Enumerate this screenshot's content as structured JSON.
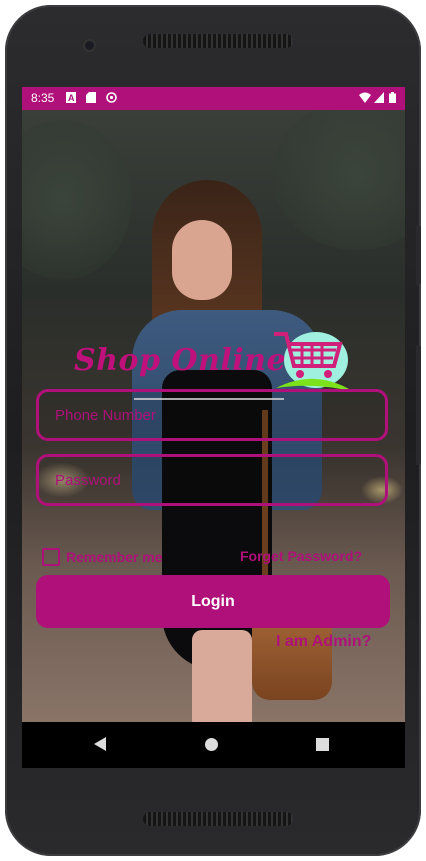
{
  "status_bar": {
    "time": "8:35",
    "left_icons": [
      "notification-a-icon",
      "sd-card-icon",
      "sync-icon"
    ],
    "right_icons": [
      "wifi-icon",
      "signal-icon",
      "battery-icon"
    ]
  },
  "brand": {
    "title": "Shop Online",
    "logo_icon": "shopping-cart-icon",
    "color": "#c0107c"
  },
  "login_form": {
    "phone_placeholder": "Phone Number",
    "password_placeholder": "Password",
    "remember_label": "Remember me",
    "forget_password": "Forget Password?",
    "login_button": "Login",
    "admin_link": "I am Admin?"
  },
  "theme": {
    "accent": "#b0107a",
    "text_on_accent": "#ffffff"
  },
  "nav_bar": {
    "icons": [
      "back-icon",
      "home-icon",
      "recents-icon"
    ]
  }
}
